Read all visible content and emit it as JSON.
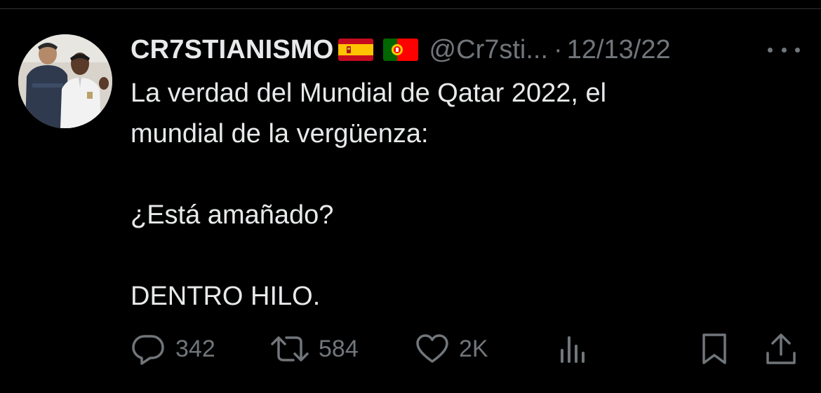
{
  "tweet": {
    "author": {
      "display_name": "CR7STIANISMO",
      "flags": [
        "spain-flag",
        "portugal-flag"
      ],
      "handle": "@Cr7sti...",
      "avatar_description": "avatar"
    },
    "separator": "·",
    "date": "12/13/22",
    "text_lines": [
      "La verdad del Mundial de Qatar 2022, el",
      "mundial de la vergüenza:",
      "",
      "¿Está amañado?",
      "",
      "DENTRO HILO."
    ],
    "stats": {
      "replies": "342",
      "retweets": "584",
      "likes": "2K"
    },
    "icons": {
      "reply": "reply-icon",
      "retweet": "retweet-icon",
      "like": "heart-icon",
      "views": "analytics-icon",
      "bookmark": "bookmark-icon",
      "share": "share-icon",
      "more": "more-icon"
    }
  },
  "colors": {
    "background": "#000000",
    "text_primary": "#e7e9ea",
    "text_secondary": "#71767b",
    "divider": "#2f3336"
  }
}
